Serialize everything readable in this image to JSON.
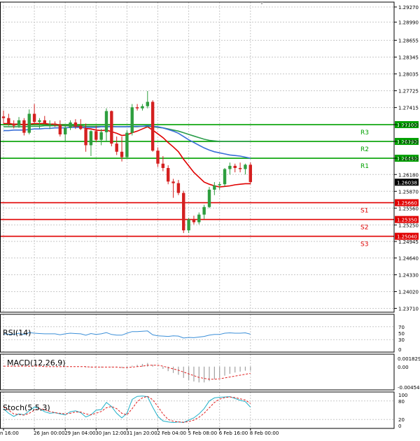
{
  "chart_data": {
    "type": "candlestick",
    "symbol_note": "",
    "price_axis": {
      "ticks": [
        "1.29270",
        "1.28990",
        "1.28655",
        "1.28345",
        "1.28035",
        "1.27725",
        "1.27415",
        "1.27100",
        "1.26790",
        "1.26480",
        "1.26180",
        "1.25870",
        "1.25560",
        "1.25250",
        "1.24945",
        "1.24640",
        "1.24330",
        "1.24020",
        "1.23710"
      ],
      "ylim": [
        1.2364,
        1.2936
      ],
      "current_price": "1.26038"
    },
    "time_axis": {
      "labels": [
        "n 16:00",
        "26 Jan 00:00",
        "29 Jan 04:00",
        "30 Jan 12:00",
        "31 Jan 20:00",
        "2 Feb 04:00",
        "5 Feb 08:00",
        "6 Feb 16:00",
        "8 Feb 00:00"
      ],
      "label_index": [
        0,
        6,
        12,
        18,
        24,
        30,
        36,
        42,
        48
      ]
    },
    "levels": [
      {
        "name": "R3",
        "value": 1.271,
        "color": "#00a000"
      },
      {
        "name": "R2",
        "value": 1.2679,
        "color": "#00a000"
      },
      {
        "name": "R1",
        "value": 1.2648,
        "color": "#00a000"
      },
      {
        "name": "S1",
        "value": 1.2566,
        "color": "#e00000"
      },
      {
        "name": "S2",
        "value": 1.2535,
        "color": "#e00000"
      },
      {
        "name": "S3",
        "value": 1.2504,
        "color": "#e00000"
      }
    ],
    "level_labels": {
      "R3": "1.27100",
      "R2": "1.26790",
      "R1": "1.26480",
      "S1": "1.25660",
      "S2": "1.25350",
      "S3": "1.25040"
    },
    "candles": [
      [
        1.2725,
        1.2736,
        1.2712,
        1.2722
      ],
      [
        1.2722,
        1.273,
        1.2708,
        1.2712
      ],
      [
        1.2712,
        1.2718,
        1.2703,
        1.2708
      ],
      [
        1.2708,
        1.2724,
        1.2704,
        1.2718
      ],
      [
        1.2718,
        1.2722,
        1.269,
        1.2695
      ],
      [
        1.2695,
        1.2738,
        1.2692,
        1.273
      ],
      [
        1.273,
        1.2748,
        1.2712,
        1.2715
      ],
      [
        1.2715,
        1.2722,
        1.2703,
        1.2718
      ],
      [
        1.2718,
        1.2726,
        1.271,
        1.2712
      ],
      [
        1.2712,
        1.2718,
        1.2702,
        1.2712
      ],
      [
        1.2712,
        1.2716,
        1.2706,
        1.271
      ],
      [
        1.271,
        1.2718,
        1.2688,
        1.2692
      ],
      [
        1.2692,
        1.2708,
        1.268,
        1.2704
      ],
      [
        1.2704,
        1.2718,
        1.27,
        1.2714
      ],
      [
        1.2714,
        1.272,
        1.2702,
        1.2708
      ],
      [
        1.2708,
        1.272,
        1.27,
        1.2702
      ],
      [
        1.2702,
        1.2712,
        1.266,
        1.2672
      ],
      [
        1.2672,
        1.27,
        1.2652,
        1.2698
      ],
      [
        1.2698,
        1.2708,
        1.2678,
        1.2682
      ],
      [
        1.2682,
        1.2702,
        1.2672,
        1.2696
      ],
      [
        1.2696,
        1.274,
        1.268,
        1.2735
      ],
      [
        1.2735,
        1.2736,
        1.267,
        1.2675
      ],
      [
        1.2675,
        1.2688,
        1.2654,
        1.266
      ],
      [
        1.266,
        1.2688,
        1.2642,
        1.265
      ],
      [
        1.265,
        1.27,
        1.2648,
        1.2695
      ],
      [
        1.2695,
        1.2748,
        1.269,
        1.2742
      ],
      [
        1.2742,
        1.2748,
        1.2736,
        1.274
      ],
      [
        1.274,
        1.2748,
        1.2736,
        1.2744
      ],
      [
        1.2744,
        1.2772,
        1.274,
        1.2752
      ],
      [
        1.2752,
        1.2755,
        1.266,
        1.2662
      ],
      [
        1.2662,
        1.2668,
        1.2632,
        1.2638
      ],
      [
        1.2638,
        1.2652,
        1.2624,
        1.263
      ],
      [
        1.263,
        1.2635,
        1.26,
        1.2605
      ],
      [
        1.2605,
        1.261,
        1.2575,
        1.2602
      ],
      [
        1.2602,
        1.2608,
        1.258,
        1.2584
      ],
      [
        1.2584,
        1.2588,
        1.251,
        1.2515
      ],
      [
        1.2515,
        1.2538,
        1.251,
        1.2535
      ],
      [
        1.2535,
        1.2542,
        1.2526,
        1.253
      ],
      [
        1.253,
        1.2548,
        1.2526,
        1.2544
      ],
      [
        1.2544,
        1.2562,
        1.2536,
        1.2558
      ],
      [
        1.2558,
        1.2595,
        1.2556,
        1.259
      ],
      [
        1.259,
        1.2604,
        1.258,
        1.2598
      ],
      [
        1.2598,
        1.2604,
        1.259,
        1.26
      ],
      [
        1.26,
        1.263,
        1.2596,
        1.2628
      ],
      [
        1.2628,
        1.264,
        1.2618,
        1.2634
      ],
      [
        1.2634,
        1.2638,
        1.2622,
        1.263
      ],
      [
        1.263,
        1.264,
        1.2622,
        1.2628
      ],
      [
        1.2628,
        1.2638,
        1.2618,
        1.2636
      ],
      [
        1.2636,
        1.264,
        1.26,
        1.2604
      ]
    ],
    "moving_averages": [
      {
        "color": "#e00000",
        "values": [
          1.2712,
          1.2712,
          1.2711,
          1.2711,
          1.271,
          1.2711,
          1.2712,
          1.2712,
          1.2712,
          1.2711,
          1.2711,
          1.2709,
          1.2708,
          1.2708,
          1.2707,
          1.2706,
          1.2703,
          1.2702,
          1.27,
          1.2699,
          1.27,
          1.2697,
          1.2694,
          1.269,
          1.2691,
          1.2695,
          1.2698,
          1.2702,
          1.2706,
          1.27,
          1.2693,
          1.2686,
          1.2677,
          1.2669,
          1.266,
          1.2646,
          1.2634,
          1.2622,
          1.2613,
          1.2604,
          1.26,
          1.2597,
          1.2595,
          1.2596,
          1.2597,
          1.2599,
          1.26,
          1.2601,
          1.2601
        ]
      },
      {
        "color": "#2a9d4a",
        "values": [
          1.2706,
          1.2706,
          1.2706,
          1.2706,
          1.2706,
          1.2707,
          1.2707,
          1.2707,
          1.2708,
          1.2708,
          1.2708,
          1.2708,
          1.2708,
          1.2708,
          1.2708,
          1.2708,
          1.2707,
          1.2707,
          1.2707,
          1.2707,
          1.2707,
          1.2707,
          1.2706,
          1.2706,
          1.2706,
          1.2706,
          1.2706,
          1.2707,
          1.2707,
          1.2706,
          1.2705,
          1.2704,
          1.2702,
          1.27,
          1.2698,
          1.2695,
          1.2692,
          1.2689,
          1.2686,
          1.2683,
          1.2681,
          1.268,
          1.2679,
          1.2679,
          1.2679,
          1.2679,
          1.2679,
          1.2679,
          1.2679
        ]
      },
      {
        "color": "#3a6fd8",
        "values": [
          1.2699,
          1.2699,
          1.27,
          1.27,
          1.27,
          1.2701,
          1.2702,
          1.2702,
          1.2703,
          1.2703,
          1.2704,
          1.2704,
          1.2704,
          1.2705,
          1.2705,
          1.2705,
          1.2705,
          1.2705,
          1.2705,
          1.2706,
          1.2706,
          1.2706,
          1.2706,
          1.2706,
          1.2706,
          1.2707,
          1.2707,
          1.2707,
          1.2708,
          1.2707,
          1.2706,
          1.2704,
          1.2701,
          1.2698,
          1.2694,
          1.2688,
          1.2682,
          1.2677,
          1.2672,
          1.2667,
          1.2663,
          1.266,
          1.2658,
          1.2656,
          1.2654,
          1.2653,
          1.2652,
          1.265,
          1.2648
        ]
      }
    ],
    "rsi": {
      "label": "RSI(14)",
      "ticks": [
        "70",
        "50",
        "30",
        "0"
      ],
      "values": [
        48,
        47,
        46,
        50,
        46,
        52,
        50,
        49,
        48,
        48,
        48,
        45,
        48,
        50,
        49,
        48,
        44,
        49,
        46,
        48,
        52,
        46,
        44,
        44,
        50,
        55,
        55,
        56,
        57,
        45,
        42,
        41,
        40,
        42,
        41,
        35,
        37,
        36,
        38,
        40,
        44,
        46,
        46,
        50,
        51,
        50,
        50,
        51,
        47
      ]
    },
    "macd": {
      "label": "MACD(12,26,9)",
      "ticks": [
        "0.001829",
        "0.00",
        "-0.004542"
      ],
      "hist": [
        0.0002,
        0.0001,
        0.0001,
        0.0001,
        0.0,
        0.0001,
        0.0001,
        0.0,
        0.0,
        0.0,
        0.0,
        -0.0001,
        -0.0001,
        0.0,
        0.0,
        0.0,
        -0.0002,
        -0.0002,
        -0.0002,
        -0.0002,
        0.0,
        -0.0001,
        -0.0002,
        -0.0003,
        -0.0002,
        0.0002,
        0.0004,
        0.0006,
        0.0008,
        0.0004,
        0.0,
        -0.0005,
        -0.001,
        -0.0014,
        -0.0018,
        -0.0025,
        -0.003,
        -0.0033,
        -0.0035,
        -0.0035,
        -0.0032,
        -0.0028,
        -0.0025,
        -0.002,
        -0.0016,
        -0.0013,
        -0.0011,
        -0.0009,
        -0.0009
      ],
      "signal": [
        0.0001,
        0.0001,
        0.0001,
        0.0001,
        0.0001,
        0.0001,
        0.0001,
        0.0001,
        0.0,
        0.0,
        0.0,
        0.0,
        0.0,
        0.0,
        0.0,
        0.0,
        0.0,
        -0.0001,
        -0.0001,
        -0.0001,
        -0.0001,
        -0.0001,
        -0.0001,
        -0.0002,
        -0.0002,
        -0.0001,
        0.0,
        0.0001,
        0.0003,
        0.0003,
        0.0003,
        0.0001,
        -0.0002,
        -0.0005,
        -0.0008,
        -0.0012,
        -0.0016,
        -0.002,
        -0.0024,
        -0.0026,
        -0.0028,
        -0.0028,
        -0.0027,
        -0.0025,
        -0.0023,
        -0.0021,
        -0.0019,
        -0.0017,
        -0.0015
      ]
    },
    "stoch": {
      "label": "Stoch(5,5,3)",
      "ticks": [
        "100",
        "80",
        "20",
        "0"
      ],
      "k": [
        55,
        40,
        30,
        38,
        35,
        48,
        60,
        55,
        45,
        40,
        42,
        38,
        35,
        45,
        48,
        42,
        28,
        35,
        50,
        52,
        75,
        62,
        40,
        25,
        40,
        85,
        95,
        96,
        94,
        60,
        30,
        15,
        12,
        10,
        12,
        10,
        18,
        25,
        38,
        55,
        80,
        90,
        92,
        93,
        94,
        88,
        82,
        78,
        60
      ],
      "d": [
        60,
        50,
        38,
        36,
        34,
        40,
        50,
        55,
        52,
        46,
        42,
        40,
        38,
        40,
        44,
        44,
        38,
        35,
        40,
        46,
        58,
        62,
        55,
        40,
        35,
        55,
        78,
        90,
        95,
        84,
        62,
        38,
        20,
        14,
        12,
        11,
        13,
        18,
        27,
        40,
        58,
        75,
        86,
        91,
        93,
        91,
        87,
        83,
        72
      ]
    }
  }
}
